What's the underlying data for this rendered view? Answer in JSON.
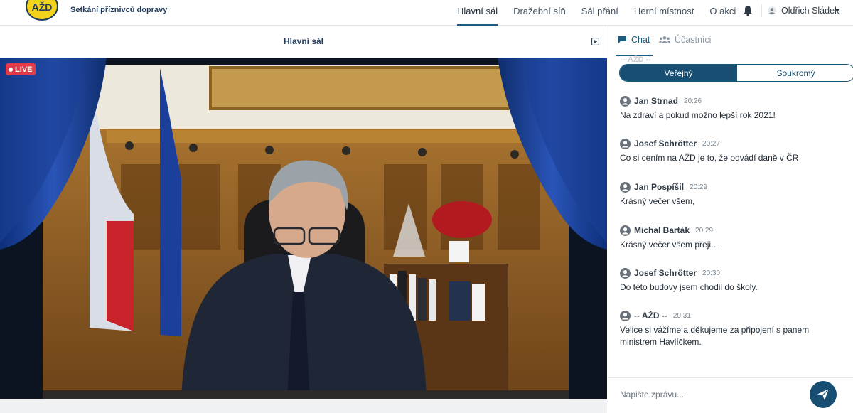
{
  "header": {
    "brand": "Setkání příznivců dopravy",
    "logo_text": "AŽD",
    "nav": [
      {
        "label": "Hlavní sál",
        "active": true
      },
      {
        "label": "Dražební síň",
        "active": false
      },
      {
        "label": "Sál přání",
        "active": false
      },
      {
        "label": "Herní místnost",
        "active": false
      },
      {
        "label": "O akci",
        "active": false
      }
    ],
    "user_name": "Oldřich Sládek"
  },
  "video": {
    "title": "Hlavní sál",
    "live_label": "LIVE"
  },
  "panel": {
    "tabs": {
      "chat": "Chat",
      "participants": "Účastníci"
    },
    "ghost_author": "-- AŽD --",
    "toggle": {
      "public": "Veřejný",
      "private": "Soukromý"
    },
    "messages": [
      {
        "author": "Jan Strnad",
        "time": "20:26",
        "text": "Na zdraví a pokud možno lepší rok 2021!"
      },
      {
        "author": "Josef Schrötter",
        "time": "20:27",
        "text": "Co si cením na AŽD je to, že odvádí daně v ČR"
      },
      {
        "author": "Jan Pospíšil",
        "time": "20:29",
        "text": "Krásný večer všem,"
      },
      {
        "author": "Michal Barták",
        "time": "20:29",
        "text": "Krásný večer všem přeji..."
      },
      {
        "author": "Josef Schrötter",
        "time": "20:30",
        "text": "Do této budovy jsem chodil do školy."
      },
      {
        "author": "-- AŽD --",
        "time": "20:31",
        "text": "Velice si vážíme a děkujeme za připojení s panem ministrem Havlíčkem."
      }
    ],
    "composer_placeholder": "Napište zprávu..."
  },
  "colors": {
    "accent": "#174e72",
    "live": "#e23a46",
    "logo_yellow": "#f2d21a"
  }
}
